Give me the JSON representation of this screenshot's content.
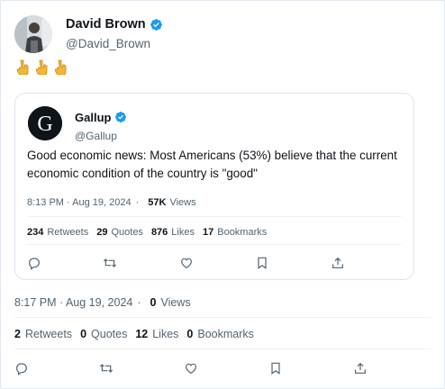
{
  "tweet": {
    "author": {
      "name": "David Brown",
      "handle": "@David_Brown"
    },
    "text": "👇👇👇",
    "timestamp": "8:17 PM · Aug 19, 2024",
    "views": "0",
    "views_label": "Views",
    "stats": {
      "retweets": "2",
      "retweets_label": "Retweets",
      "quotes": "0",
      "quotes_label": "Quotes",
      "likes": "12",
      "likes_label": "Likes",
      "bookmarks": "0",
      "bookmarks_label": "Bookmarks"
    }
  },
  "quoted": {
    "author": {
      "name": "Gallup",
      "handle": "@Gallup"
    },
    "text": "Good economic news: Most Americans (53%) believe that the current economic condition of the country is \"good\"",
    "timestamp": "8:13 PM · Aug 19, 2024",
    "views": "57K",
    "views_label": "Views",
    "stats": {
      "retweets": "234",
      "retweets_label": "Retweets",
      "quotes": "29",
      "quotes_label": "Quotes",
      "likes": "876",
      "likes_label": "Likes",
      "bookmarks": "17",
      "bookmarks_label": "Bookmarks"
    }
  },
  "dot": "·",
  "colors": {
    "verified": "#1d9bf0",
    "secondary_text": "#536471",
    "primary_text": "#0f1419"
  },
  "icons": [
    "verified-badge-icon",
    "pointing-down-emoji-icon",
    "reply-icon",
    "retweet-icon",
    "like-icon",
    "bookmark-icon",
    "share-icon"
  ]
}
